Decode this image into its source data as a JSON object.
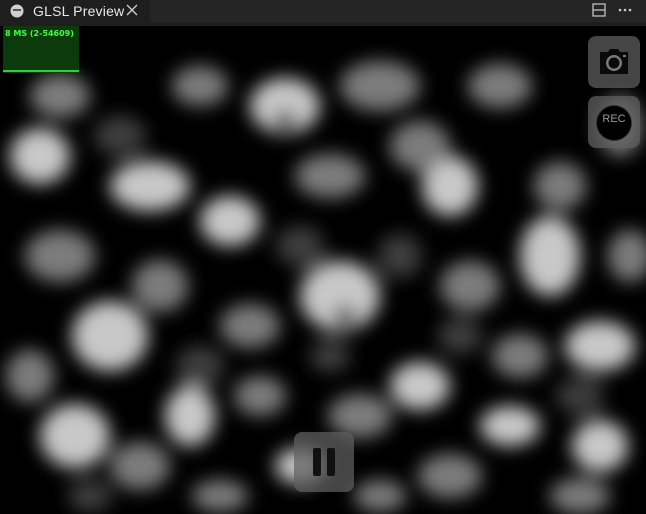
{
  "tab": {
    "title": "GLSL Preview",
    "icon": "glsl-preview-icon",
    "close_icon": "close-icon"
  },
  "toolbar": {
    "actions": [
      "split-editor-icon",
      "more-actions-icon"
    ]
  },
  "preview": {
    "stats": "8 MS (2-54609)",
    "rec_label": "REC",
    "buttons": [
      "camera-icon",
      "record-icon",
      "pause-icon"
    ]
  },
  "colors": {
    "stats_text": "#3cff3c",
    "stats_bg": "#0c3a0c",
    "background": "#000000",
    "button": "#5f5f5f"
  }
}
